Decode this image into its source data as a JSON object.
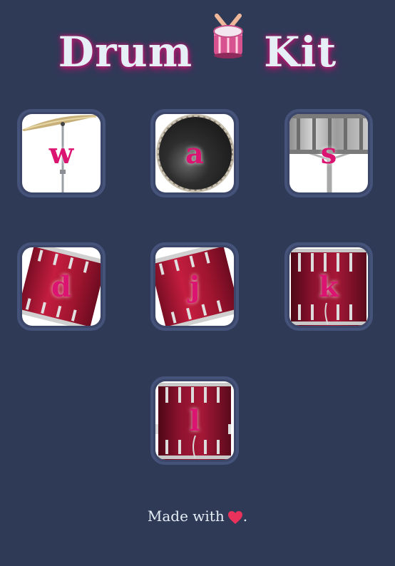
{
  "header": {
    "title_left": "Drum",
    "title_right": "Kit",
    "icon": "drum-icon"
  },
  "pads": [
    {
      "key": "w",
      "instrument": "crash-cymbal-icon"
    },
    {
      "key": "a",
      "instrument": "bass-drum-head-icon"
    },
    {
      "key": "s",
      "instrument": "snare-drum-icon"
    },
    {
      "key": "d",
      "instrument": "tom-1-icon"
    },
    {
      "key": "j",
      "instrument": "tom-2-icon"
    },
    {
      "key": "k",
      "instrument": "floor-tom-icon"
    },
    {
      "key": "l",
      "instrument": "bass-drum-icon"
    }
  ],
  "footer": {
    "text": "Made with",
    "icon": "heart-icon",
    "suffix": "."
  },
  "colors": {
    "background": "#2f3a57",
    "key": "#da1470",
    "tile_border": "#45527a",
    "drum_red": "#b31836"
  }
}
